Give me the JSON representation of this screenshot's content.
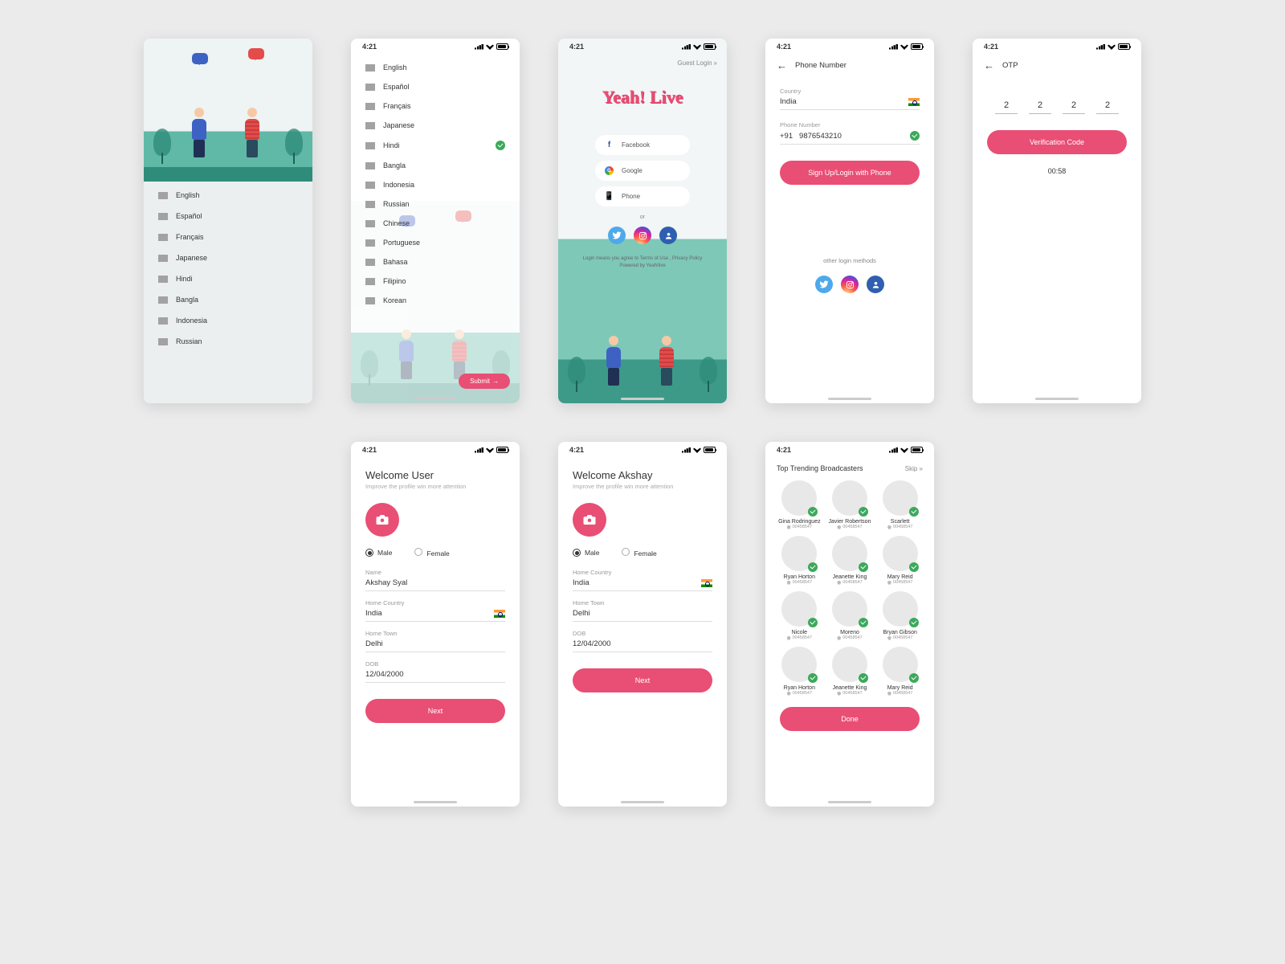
{
  "status_time": "4:21",
  "languages_short": [
    "English",
    "Español",
    "Français",
    "Japanese",
    "Hindi",
    "Bangla",
    "Indonesia",
    "Russian"
  ],
  "languages_full": [
    "English",
    "Español",
    "Français",
    "Japanese",
    "Hindi",
    "Bangla",
    "Indonesia",
    "Russian",
    "Chinese",
    "Portuguese",
    "Bahasa",
    "Filipino",
    "Korean"
  ],
  "selected_language_index": 4,
  "submit_label": "Submit",
  "screen3": {
    "guest": "Guest Login",
    "logo": "Yeah! Live",
    "methods": [
      "Facebook",
      "Google",
      "Phone"
    ],
    "or": "or",
    "fine1": "Login means you agree to  Terms of Use , Privacy Policy",
    "fine2": "Powered by  Yeah!live"
  },
  "screen4": {
    "title": "Phone Number",
    "country_label": "Country",
    "country": "India",
    "phone_label": "Phone Number",
    "cc": "+91",
    "phone": "9876543210",
    "btn": "Sign Up/Login with Phone",
    "other": "other login methods"
  },
  "screen5": {
    "title": "OTP",
    "digits": [
      "2",
      "2",
      "2",
      "2"
    ],
    "btn": "Verification Code",
    "timer": "00:58"
  },
  "screen6": {
    "title": "Welcome User",
    "sub": "Improve the profile win more attention",
    "male": "Male",
    "female": "Female",
    "name_label": "Name",
    "name": "Akshay Syal",
    "country_label": "Home Country",
    "country": "India",
    "town_label": "Home Town",
    "town": "Delhi",
    "dob_label": "DOB",
    "dob": "12/04/2000",
    "btn": "Next"
  },
  "screen7": {
    "title": "Welcome Akshay",
    "sub": "Improve the profile win more attention",
    "male": "Male",
    "female": "Female",
    "country_label": "Home Country",
    "country": "India",
    "town_label": "Home Town",
    "town": "Delhi",
    "dob_label": "DOB",
    "dob": "12/04/2000",
    "btn": "Next"
  },
  "screen8": {
    "title": "Top Trending Broadcasters",
    "skip": "Skip",
    "id": "00458547",
    "names": [
      "Gina Rodringuez",
      "Javier Robertson",
      "Scarlett",
      "Ryan Horton",
      "Jeanette King",
      "Mary Reid",
      "Nicole",
      "Moreno",
      "Bryan Gibson",
      "Ryan Horton",
      "Jeanette King",
      "Mary Reid"
    ],
    "btn": "Done"
  }
}
